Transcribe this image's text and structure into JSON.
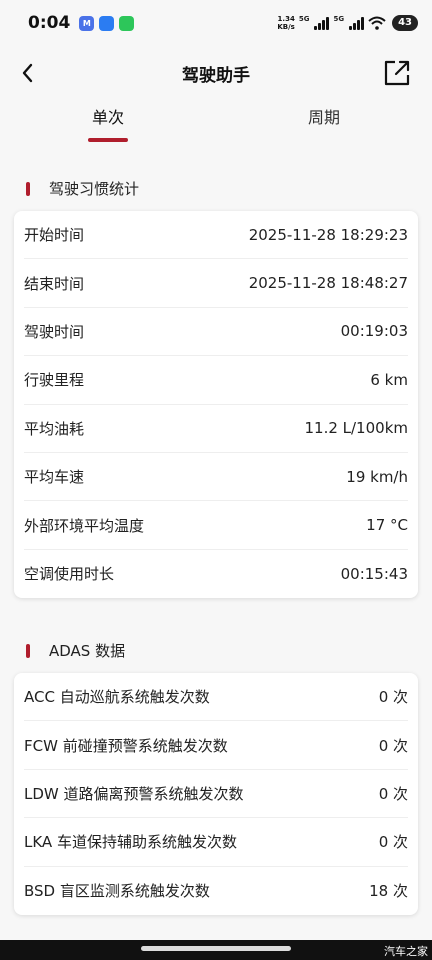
{
  "status_bar": {
    "time": "0:04",
    "net_speed_value": "1.34",
    "net_speed_unit": "KB/s",
    "signal1_label": "5G",
    "signal2_label": "5G",
    "battery": "43",
    "notification_badge": "M"
  },
  "header": {
    "title": "驾驶助手"
  },
  "tabs": [
    {
      "label": "单次",
      "active": true
    },
    {
      "label": "周期",
      "active": false
    }
  ],
  "driving_habits": {
    "title": "驾驶习惯统计",
    "rows": [
      {
        "label": "开始时间",
        "value": "2025-11-28 18:29:23"
      },
      {
        "label": "结束时间",
        "value": "2025-11-28 18:48:27"
      },
      {
        "label": "驾驶时间",
        "value": "00:19:03"
      },
      {
        "label": "行驶里程",
        "value": "6 km"
      },
      {
        "label": "平均油耗",
        "value": "11.2 L/100km"
      },
      {
        "label": "平均车速",
        "value": "19 km/h"
      },
      {
        "label": "外部环境平均温度",
        "value": "17 °C"
      },
      {
        "label": "空调使用时长",
        "value": "00:15:43"
      }
    ]
  },
  "adas": {
    "title": "ADAS 数据",
    "rows": [
      {
        "label": "ACC 自动巡航系统触发次数",
        "value": "0 次"
      },
      {
        "label": "FCW 前碰撞预警系统触发次数",
        "value": "0 次"
      },
      {
        "label": "LDW 道路偏离预警系统触发次数",
        "value": "0 次"
      },
      {
        "label": "LKA 车道保持辅助系统触发次数",
        "value": "0 次"
      },
      {
        "label": "BSD 盲区监测系统触发次数",
        "value": "18 次"
      }
    ]
  },
  "watermark": "汽车之家",
  "colors": {
    "accent": "#b01e2d",
    "background": "#f7f7f7",
    "card": "#ffffff"
  }
}
